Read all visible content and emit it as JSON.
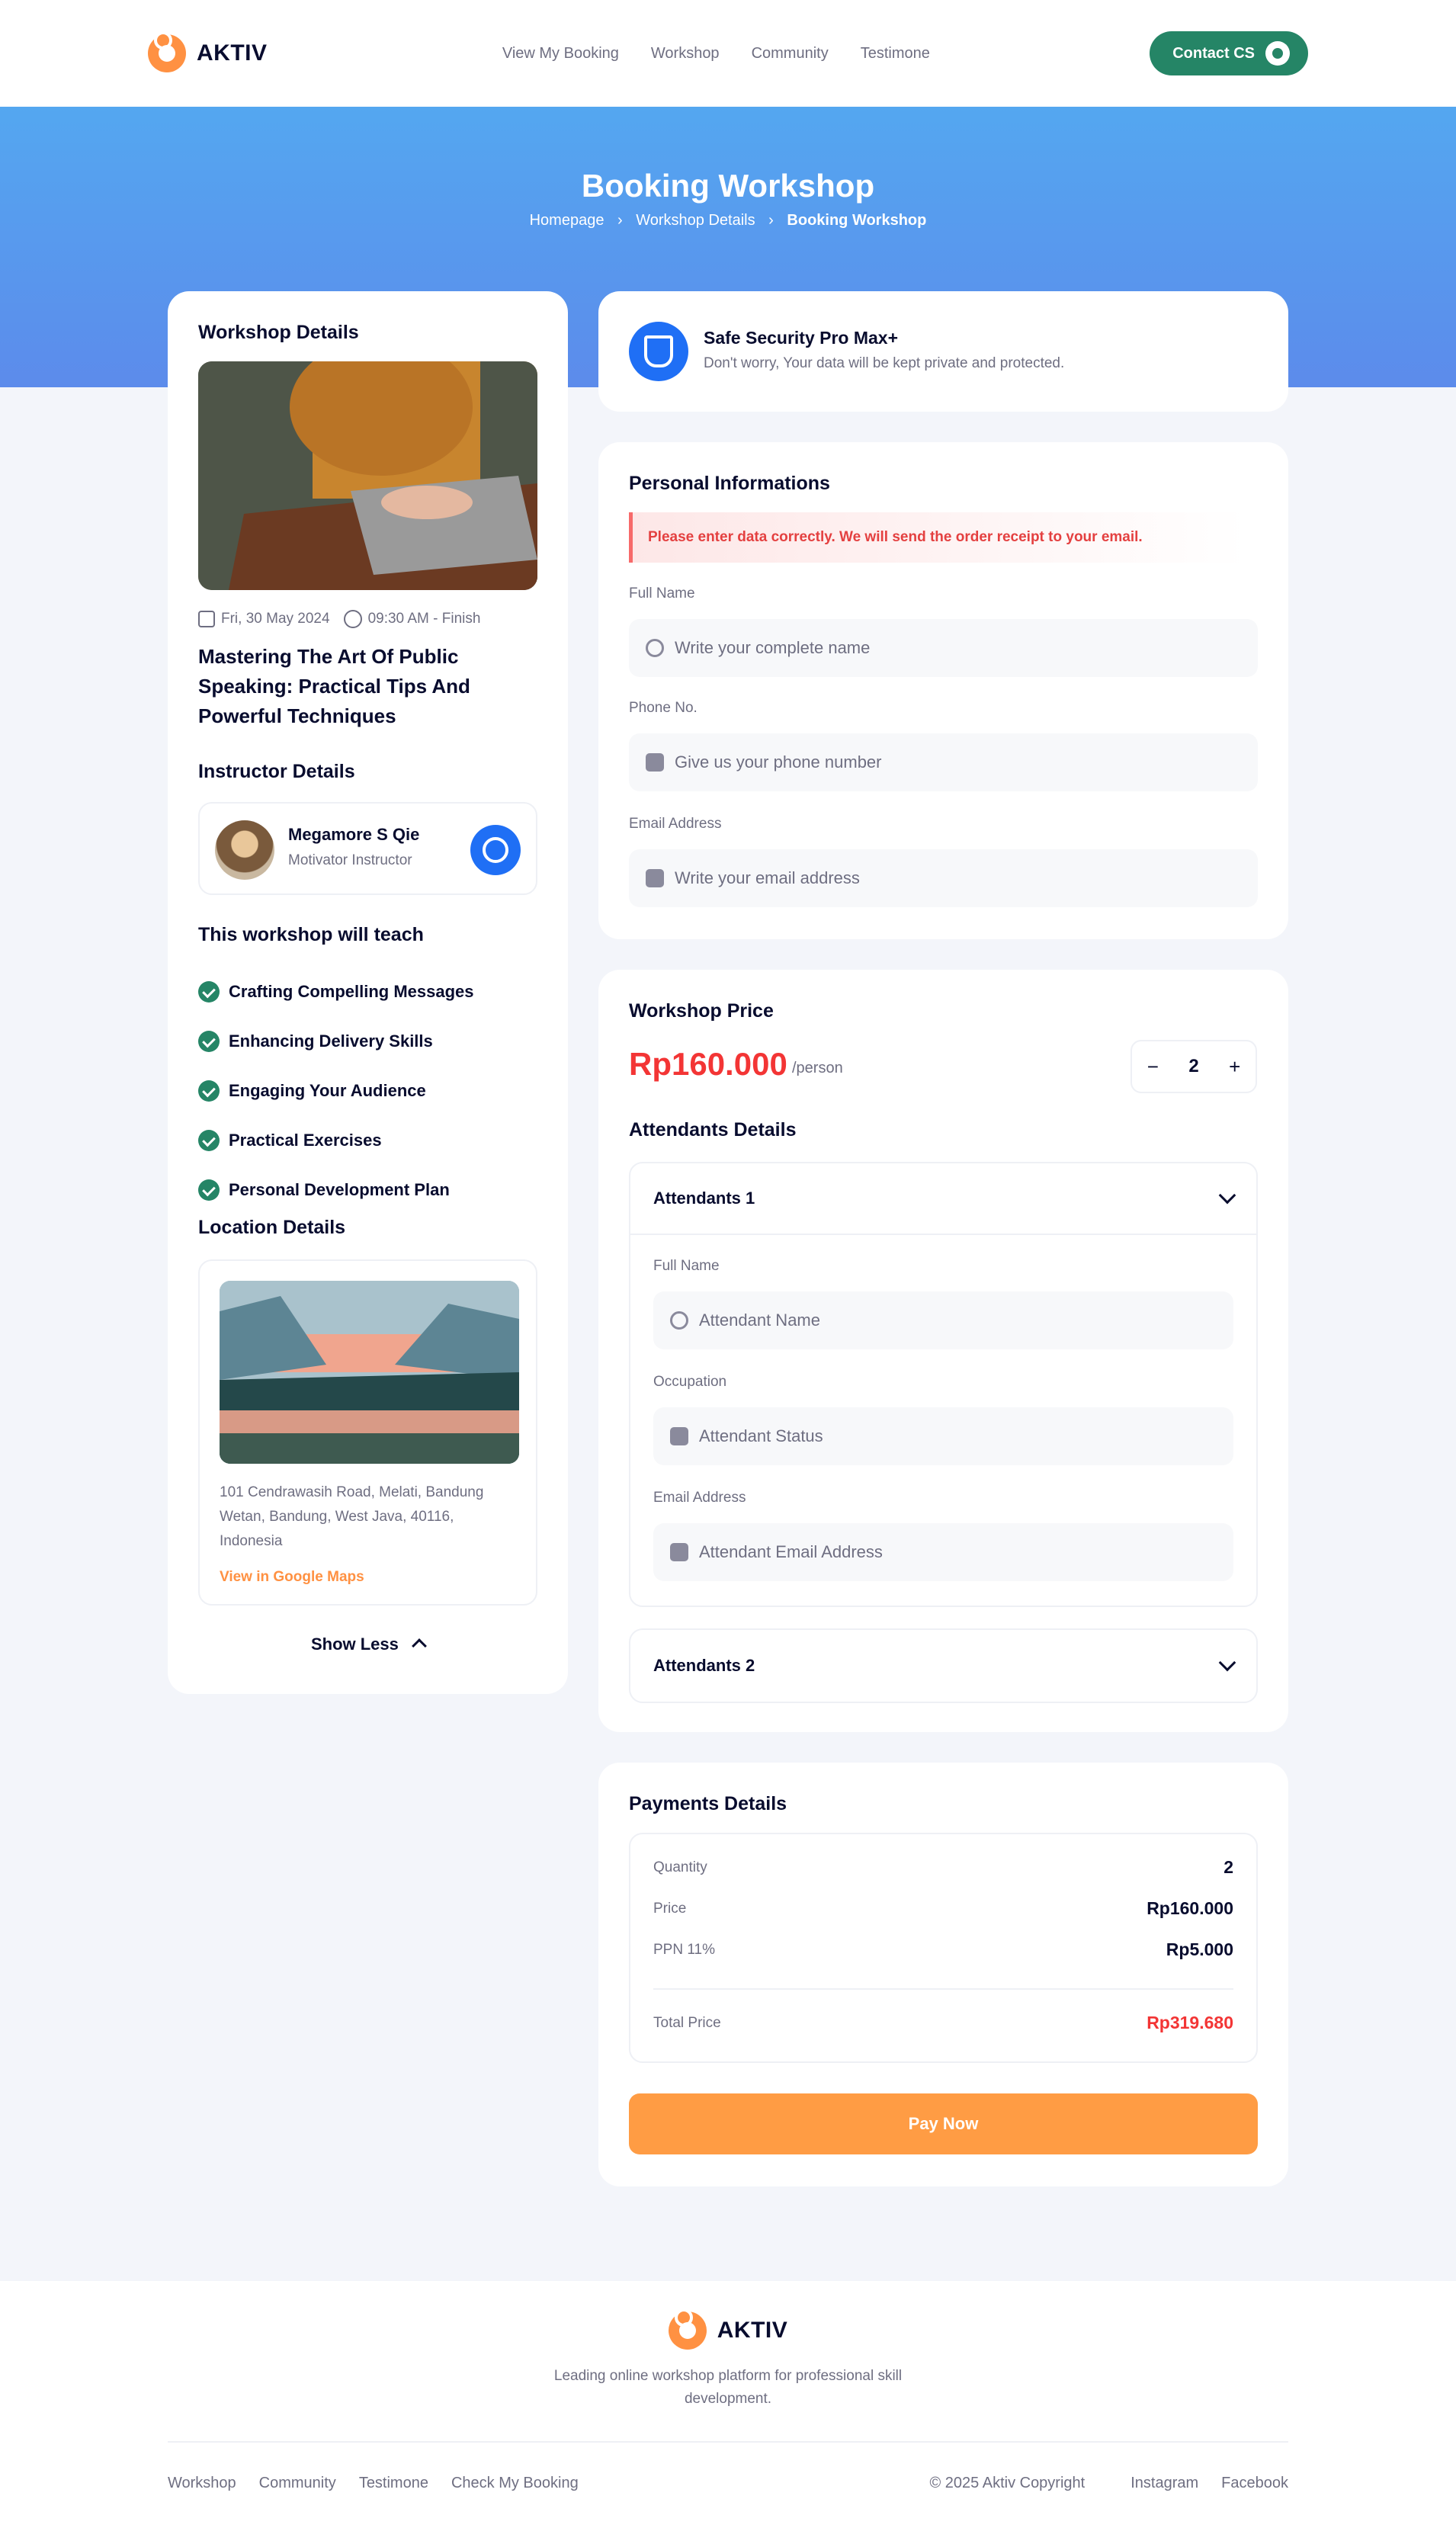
{
  "nav": {
    "brand": "AKTIV",
    "links": [
      "View My Booking",
      "Workshop",
      "Community",
      "Testimone"
    ],
    "contact_label": "Contact CS"
  },
  "hero": {
    "title": "Booking Workshop",
    "breadcrumb": [
      "Homepage",
      "Workshop Details",
      "Booking Workshop"
    ]
  },
  "workshop": {
    "heading": "Workshop Details",
    "date": "Fri, 30 May 2024",
    "time": "09:30 AM - Finish",
    "title": "Mastering The Art Of Public Speaking: Practical Tips And Powerful Techniques",
    "instructor_heading": "Instructor Details",
    "instructor_name": "Megamore S Qie",
    "instructor_role": "Motivator Instructor",
    "teach_heading": "This workshop will teach",
    "teach_items": [
      "Crafting Compelling Messages",
      "Enhancing Delivery Skills",
      "Engaging Your Audience",
      "Practical Exercises",
      "Personal Development Plan"
    ],
    "location_heading": "Location Details",
    "address": "101 Cendrawasih Road, Melati, Bandung Wetan, Bandung, West Java, 40116, Indonesia",
    "map_link": "View in Google Maps",
    "show_less": "Show Less"
  },
  "security": {
    "title": "Safe Security Pro Max+",
    "subtitle": "Don't worry, Your data will be kept private and protected."
  },
  "personal": {
    "heading": "Personal Informations",
    "alert": "Please enter data correctly. We will send the order receipt to your email.",
    "full_name_label": "Full Name",
    "full_name_placeholder": "Write your complete name",
    "phone_label": "Phone No.",
    "phone_placeholder": "Give us your phone number",
    "email_label": "Email Address",
    "email_placeholder": "Write your email address"
  },
  "pricing": {
    "heading": "Workshop Price",
    "price": "Rp160.000",
    "unit": "/person",
    "quantity": "2",
    "minus": "−",
    "plus": "+",
    "attendants_heading": "Attendants Details",
    "attendant1": {
      "title": "Attendants 1",
      "name_label": "Full Name",
      "name_placeholder": "Attendant Name",
      "occupation_label": "Occupation",
      "occupation_placeholder": "Attendant Status",
      "email_label": "Email Address",
      "email_placeholder": "Attendant Email Address"
    },
    "attendant2_title": "Attendants 2"
  },
  "payment": {
    "heading": "Payments Details",
    "quantity_label": "Quantity",
    "quantity_value": "2",
    "price_label": "Price",
    "price_value": "Rp160.000",
    "tax_label": "PPN 11%",
    "tax_value": "Rp5.000",
    "total_label": "Total Price",
    "total_value": "Rp319.680",
    "pay_label": "Pay Now"
  },
  "footer": {
    "brand": "AKTIV",
    "tagline": "Leading online workshop platform for professional skill development.",
    "links": [
      "Workshop",
      "Community",
      "Testimone",
      "Check My Booking"
    ],
    "copyright": "© 2025 Aktiv Copyright",
    "social": [
      "Instagram",
      "Facebook"
    ]
  },
  "colors": {
    "primary_green": "#258566",
    "accent_orange": "#FF9142",
    "price_red": "#F33535",
    "hero_blue": "#54A7F0"
  }
}
